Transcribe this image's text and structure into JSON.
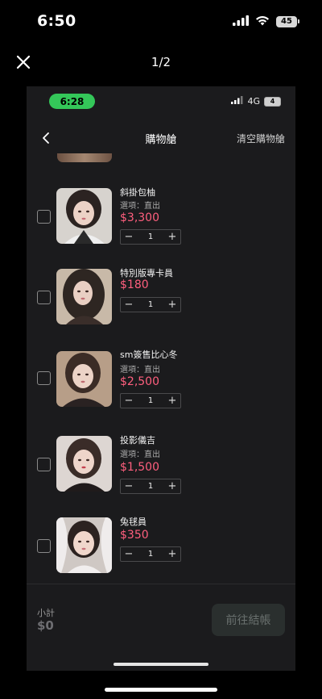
{
  "status_bar": {
    "time": "6:50",
    "battery": "45"
  },
  "viewer": {
    "counter": "1/2"
  },
  "inner": {
    "status_bar": {
      "time": "6:28",
      "network": "4G",
      "battery": "4"
    },
    "nav": {
      "title": "購物艙",
      "clear_label": "清空購物艙"
    },
    "items": [
      {
        "name": "斜掛包柚",
        "option": "選項：直出",
        "price": "$3,300",
        "qty": "1"
      },
      {
        "name": "特別版專卡員",
        "option": "",
        "price": "$180",
        "qty": "1"
      },
      {
        "name": "sm簽售比心冬",
        "option": "選項：直出",
        "price": "$2,500",
        "qty": "1"
      },
      {
        "name": "投影儀吉",
        "option": "選項：直出",
        "price": "$1,500",
        "qty": "1"
      },
      {
        "name": "兔毬員",
        "option": "",
        "price": "$350",
        "qty": "1"
      }
    ],
    "stepper": {
      "minus": "−",
      "plus": "+"
    },
    "footer": {
      "subtotal_label": "小計",
      "subtotal_value": "$0",
      "checkout_label": "前往結帳"
    }
  },
  "icons": {
    "close": "close-icon",
    "back": "chevron-left-icon",
    "wifi": "wifi-icon",
    "signal": "cellular-signal-icon",
    "battery": "battery-icon"
  },
  "colors": {
    "price": "#ff5f7e",
    "time_pill": "#34c759",
    "background": "#1b1b1d"
  }
}
